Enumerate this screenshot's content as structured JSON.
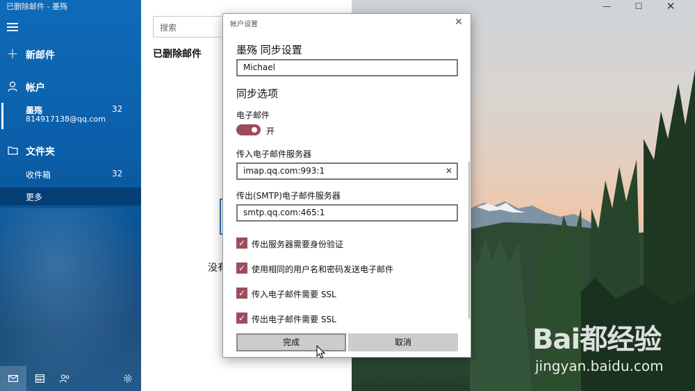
{
  "window": {
    "title": "已删除邮件 - 墨殇"
  },
  "sidebar": {
    "new_mail": "新邮件",
    "accounts_label": "帐户",
    "account": {
      "name": "墨殇",
      "email": "814917138@qq.com",
      "count": "32"
    },
    "folders_label": "文件夹",
    "folders": [
      {
        "label": "收件箱",
        "count": "32"
      },
      {
        "label": "更多",
        "count": ""
      }
    ]
  },
  "list": {
    "search_placeholder": "搜索",
    "folder_title": "已删除邮件",
    "empty_text": "没有"
  },
  "dialog": {
    "title": "帐户设置",
    "heading": "墨殇 同步设置",
    "display_name_value": "Michael",
    "sync_options_label": "同步选项",
    "email_label": "电子邮件",
    "email_toggle_state": "开",
    "incoming_server_label": "传入电子邮件服务器",
    "incoming_server_value": "imap.qq.com:993:1",
    "outgoing_server_label": "传出(SMTP)电子邮件服务器",
    "outgoing_server_value": "smtp.qq.com:465:1",
    "checkboxes": [
      {
        "label": "传出服务器需要身份验证",
        "checked": true
      },
      {
        "label": "使用相同的用户名和密码发送电子邮件",
        "checked": true
      },
      {
        "label": "传入电子邮件需要 SSL",
        "checked": true
      },
      {
        "label": "传出电子邮件需要 SSL",
        "checked": true
      }
    ],
    "done_button": "完成",
    "cancel_button": "取消"
  },
  "watermark": {
    "logo_text": "Bai都经验",
    "url": "jingyan.baidu.com"
  },
  "colors": {
    "sidebar_blue": "#0f6bb8",
    "accent": "#9e4b5c"
  }
}
